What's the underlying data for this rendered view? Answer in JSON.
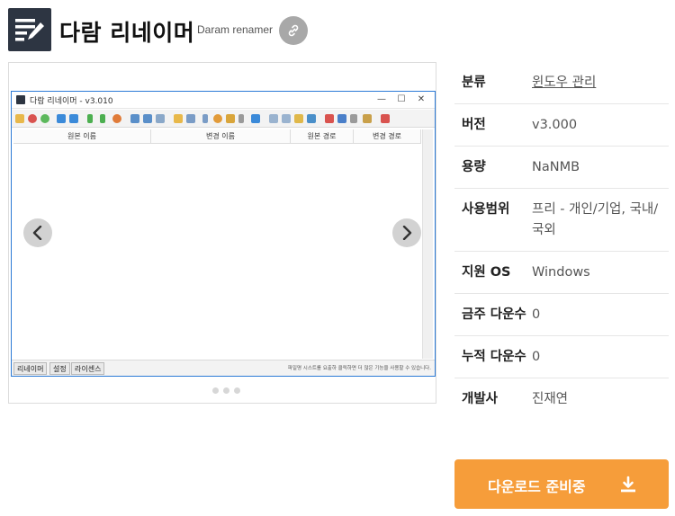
{
  "header": {
    "title": "다람 리네이머",
    "subtitle": "Daram renamer",
    "app_icon": "notes-pencil-icon",
    "link_icon": "link-icon"
  },
  "gallery": {
    "window_title": "다람 리네이머 - v3.010",
    "window_controls": [
      "—",
      "☐",
      "✕"
    ],
    "columns": [
      "원본 이름",
      "변경 이름",
      "원본 경로",
      "변경 경로"
    ],
    "status_tabs": [
      "리네이머",
      "설정",
      "라이센스"
    ],
    "status_text": "파일명 시스트를 요출하 클릭하면 더 많은 기능을 사용할 수 있습니다.",
    "dots": 3
  },
  "info": {
    "rows": [
      {
        "key": "분류",
        "value": "윈도우 관리"
      },
      {
        "key": "버전",
        "value": "v3.000"
      },
      {
        "key": "용량",
        "value": "NaNMB"
      },
      {
        "key": "사용범위",
        "value": "프리 - 개인/기업, 국내/국외"
      },
      {
        "key": "지원 OS",
        "value": "Windows"
      },
      {
        "key": "금주 다운수",
        "value": "0"
      },
      {
        "key": "누적 다운수",
        "value": "0"
      },
      {
        "key": "개발사",
        "value": "진재연"
      }
    ]
  },
  "download": {
    "label": "다운로드 준비중",
    "icon": "download-icon"
  },
  "colors": {
    "accent": "#f69d3a",
    "icon_bg": "#2d3542",
    "window_border": "#2c7ad6"
  }
}
